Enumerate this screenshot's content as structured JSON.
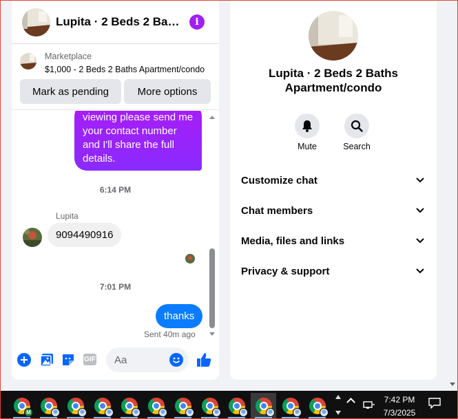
{
  "chat": {
    "header_title": "Lupita · 2 Beds 2 Baths Apartment/condo",
    "listing": {
      "source": "Marketplace",
      "title": "$1,000 - 2 Beds 2 Baths Apartment/condo",
      "pending_label": "Mark as pending",
      "more_label": "More options"
    },
    "messages": {
      "outgoing_lines": [
        "viewing please send me",
        "your contact number",
        "and I'll share the full",
        "details."
      ],
      "time_1": "6:14 PM",
      "sender_name": "Lupita",
      "incoming_text": "9094490916",
      "time_2": "7:01 PM",
      "outgoing_text": "thanks",
      "sent_status": "Sent 40m ago"
    },
    "composer": {
      "placeholder": "Aa",
      "gif_label": "GIF"
    }
  },
  "info": {
    "name": "Lupita · 2 Beds 2 Baths Apartment/condo",
    "actions": [
      {
        "label": "Mute",
        "icon": "bell-icon"
      },
      {
        "label": "Search",
        "icon": "search-icon"
      }
    ],
    "sections": [
      {
        "label": "Customize chat"
      },
      {
        "label": "Chat members"
      },
      {
        "label": "Media, files and links"
      },
      {
        "label": "Privacy & support"
      }
    ]
  },
  "taskbar": {
    "apps": [
      {
        "icon": "chrome-icon",
        "badge": "M"
      },
      {
        "icon": "chrome-icon",
        "badge": ""
      },
      {
        "icon": "chrome-icon",
        "badge": ""
      },
      {
        "icon": "chrome-icon",
        "badge": ""
      },
      {
        "icon": "chrome-icon",
        "badge": ""
      },
      {
        "icon": "chrome-icon",
        "badge": ""
      },
      {
        "icon": "chrome-icon",
        "badge": ""
      },
      {
        "icon": "chrome-icon",
        "badge": ""
      },
      {
        "icon": "chrome-icon",
        "badge": ""
      },
      {
        "icon": "chrome-icon",
        "badge": "",
        "active": true
      },
      {
        "icon": "chrome-icon",
        "badge": ""
      },
      {
        "icon": "chrome-icon",
        "badge": ""
      }
    ],
    "time": "7:42 PM",
    "date": "7/3/2025"
  },
  "colors": {
    "brand_purple": "#a020f0",
    "bubble_blue": "#0a7cff",
    "accent_blue": "#0866ff"
  }
}
